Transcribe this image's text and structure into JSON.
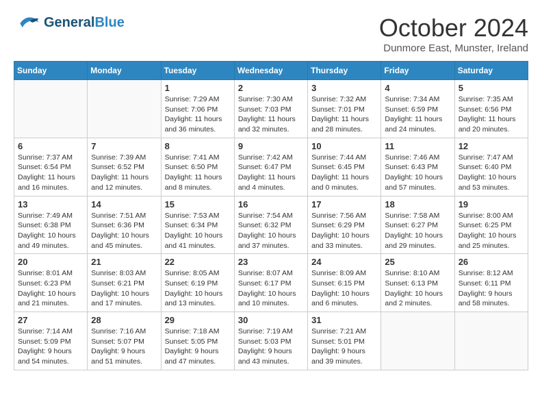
{
  "header": {
    "logo_line1": "General",
    "logo_line2": "Blue",
    "month_title": "October 2024",
    "location": "Dunmore East, Munster, Ireland"
  },
  "days_of_week": [
    "Sunday",
    "Monday",
    "Tuesday",
    "Wednesday",
    "Thursday",
    "Friday",
    "Saturday"
  ],
  "weeks": [
    [
      {
        "day": "",
        "info": ""
      },
      {
        "day": "",
        "info": ""
      },
      {
        "day": "1",
        "info": "Sunrise: 7:29 AM\nSunset: 7:06 PM\nDaylight: 11 hours and 36 minutes."
      },
      {
        "day": "2",
        "info": "Sunrise: 7:30 AM\nSunset: 7:03 PM\nDaylight: 11 hours and 32 minutes."
      },
      {
        "day": "3",
        "info": "Sunrise: 7:32 AM\nSunset: 7:01 PM\nDaylight: 11 hours and 28 minutes."
      },
      {
        "day": "4",
        "info": "Sunrise: 7:34 AM\nSunset: 6:59 PM\nDaylight: 11 hours and 24 minutes."
      },
      {
        "day": "5",
        "info": "Sunrise: 7:35 AM\nSunset: 6:56 PM\nDaylight: 11 hours and 20 minutes."
      }
    ],
    [
      {
        "day": "6",
        "info": "Sunrise: 7:37 AM\nSunset: 6:54 PM\nDaylight: 11 hours and 16 minutes."
      },
      {
        "day": "7",
        "info": "Sunrise: 7:39 AM\nSunset: 6:52 PM\nDaylight: 11 hours and 12 minutes."
      },
      {
        "day": "8",
        "info": "Sunrise: 7:41 AM\nSunset: 6:50 PM\nDaylight: 11 hours and 8 minutes."
      },
      {
        "day": "9",
        "info": "Sunrise: 7:42 AM\nSunset: 6:47 PM\nDaylight: 11 hours and 4 minutes."
      },
      {
        "day": "10",
        "info": "Sunrise: 7:44 AM\nSunset: 6:45 PM\nDaylight: 11 hours and 0 minutes."
      },
      {
        "day": "11",
        "info": "Sunrise: 7:46 AM\nSunset: 6:43 PM\nDaylight: 10 hours and 57 minutes."
      },
      {
        "day": "12",
        "info": "Sunrise: 7:47 AM\nSunset: 6:40 PM\nDaylight: 10 hours and 53 minutes."
      }
    ],
    [
      {
        "day": "13",
        "info": "Sunrise: 7:49 AM\nSunset: 6:38 PM\nDaylight: 10 hours and 49 minutes."
      },
      {
        "day": "14",
        "info": "Sunrise: 7:51 AM\nSunset: 6:36 PM\nDaylight: 10 hours and 45 minutes."
      },
      {
        "day": "15",
        "info": "Sunrise: 7:53 AM\nSunset: 6:34 PM\nDaylight: 10 hours and 41 minutes."
      },
      {
        "day": "16",
        "info": "Sunrise: 7:54 AM\nSunset: 6:32 PM\nDaylight: 10 hours and 37 minutes."
      },
      {
        "day": "17",
        "info": "Sunrise: 7:56 AM\nSunset: 6:29 PM\nDaylight: 10 hours and 33 minutes."
      },
      {
        "day": "18",
        "info": "Sunrise: 7:58 AM\nSunset: 6:27 PM\nDaylight: 10 hours and 29 minutes."
      },
      {
        "day": "19",
        "info": "Sunrise: 8:00 AM\nSunset: 6:25 PM\nDaylight: 10 hours and 25 minutes."
      }
    ],
    [
      {
        "day": "20",
        "info": "Sunrise: 8:01 AM\nSunset: 6:23 PM\nDaylight: 10 hours and 21 minutes."
      },
      {
        "day": "21",
        "info": "Sunrise: 8:03 AM\nSunset: 6:21 PM\nDaylight: 10 hours and 17 minutes."
      },
      {
        "day": "22",
        "info": "Sunrise: 8:05 AM\nSunset: 6:19 PM\nDaylight: 10 hours and 13 minutes."
      },
      {
        "day": "23",
        "info": "Sunrise: 8:07 AM\nSunset: 6:17 PM\nDaylight: 10 hours and 10 minutes."
      },
      {
        "day": "24",
        "info": "Sunrise: 8:09 AM\nSunset: 6:15 PM\nDaylight: 10 hours and 6 minutes."
      },
      {
        "day": "25",
        "info": "Sunrise: 8:10 AM\nSunset: 6:13 PM\nDaylight: 10 hours and 2 minutes."
      },
      {
        "day": "26",
        "info": "Sunrise: 8:12 AM\nSunset: 6:11 PM\nDaylight: 9 hours and 58 minutes."
      }
    ],
    [
      {
        "day": "27",
        "info": "Sunrise: 7:14 AM\nSunset: 5:09 PM\nDaylight: 9 hours and 54 minutes."
      },
      {
        "day": "28",
        "info": "Sunrise: 7:16 AM\nSunset: 5:07 PM\nDaylight: 9 hours and 51 minutes."
      },
      {
        "day": "29",
        "info": "Sunrise: 7:18 AM\nSunset: 5:05 PM\nDaylight: 9 hours and 47 minutes."
      },
      {
        "day": "30",
        "info": "Sunrise: 7:19 AM\nSunset: 5:03 PM\nDaylight: 9 hours and 43 minutes."
      },
      {
        "day": "31",
        "info": "Sunrise: 7:21 AM\nSunset: 5:01 PM\nDaylight: 9 hours and 39 minutes."
      },
      {
        "day": "",
        "info": ""
      },
      {
        "day": "",
        "info": ""
      }
    ]
  ]
}
